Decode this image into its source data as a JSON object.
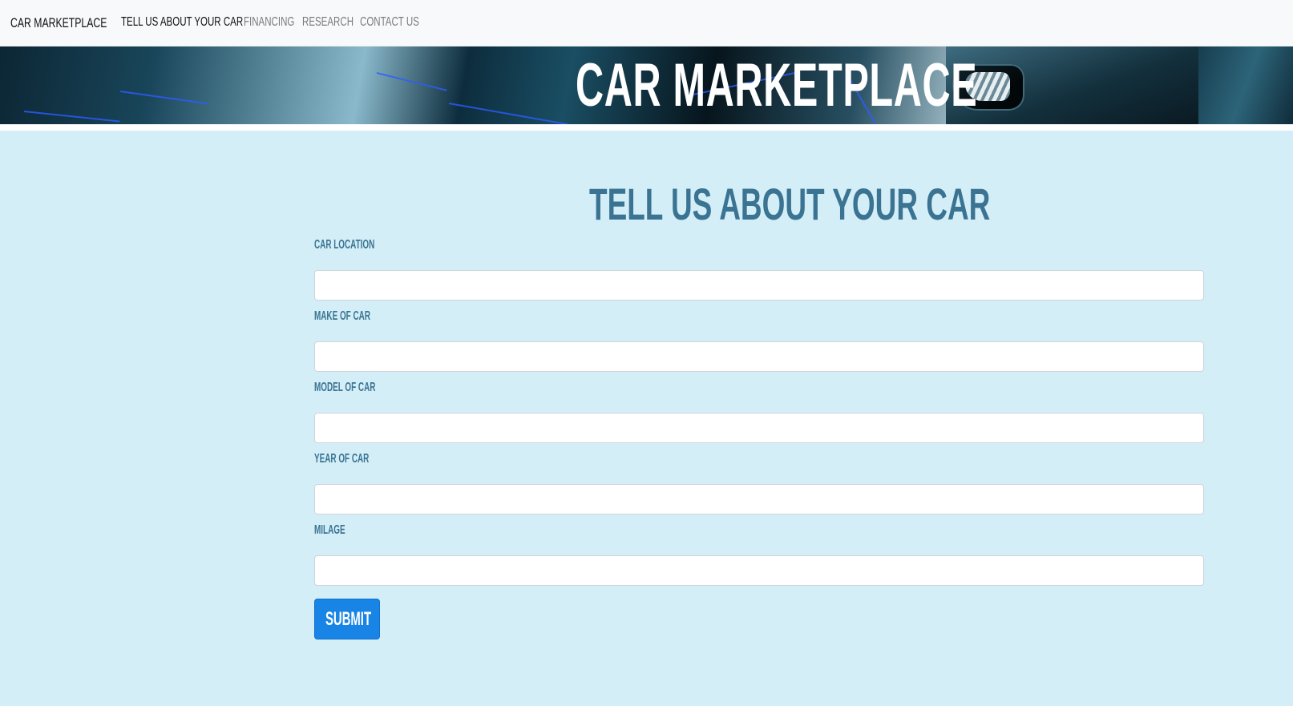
{
  "navbar": {
    "brand": "CAR MARKETPLACE",
    "links": [
      {
        "label": "TELL US ABOUT YOUR CAR",
        "active": true
      },
      {
        "label": "FINANCING",
        "active": false
      },
      {
        "label": "RESEARCH",
        "active": false
      },
      {
        "label": "CONTACT US",
        "active": false
      }
    ]
  },
  "banner": {
    "title": "CAR MARKETPLACE"
  },
  "form": {
    "title": "TELL US ABOUT YOUR CAR",
    "fields": [
      {
        "label": "CAR LOCATION",
        "value": "",
        "placeholder": ""
      },
      {
        "label": "MAKE OF CAR",
        "value": "",
        "placeholder": ""
      },
      {
        "label": "MODEL OF CAR",
        "value": "",
        "placeholder": ""
      },
      {
        "label": "YEAR OF CAR",
        "value": "",
        "placeholder": ""
      },
      {
        "label": "MILAGE",
        "value": "",
        "placeholder": ""
      }
    ],
    "submit_label": "SUBMIT"
  },
  "colors": {
    "navbar_bg": "#f8f9fa",
    "main_bg": "#d4eef8",
    "heading": "#3a7492",
    "button": "#1784e6"
  }
}
